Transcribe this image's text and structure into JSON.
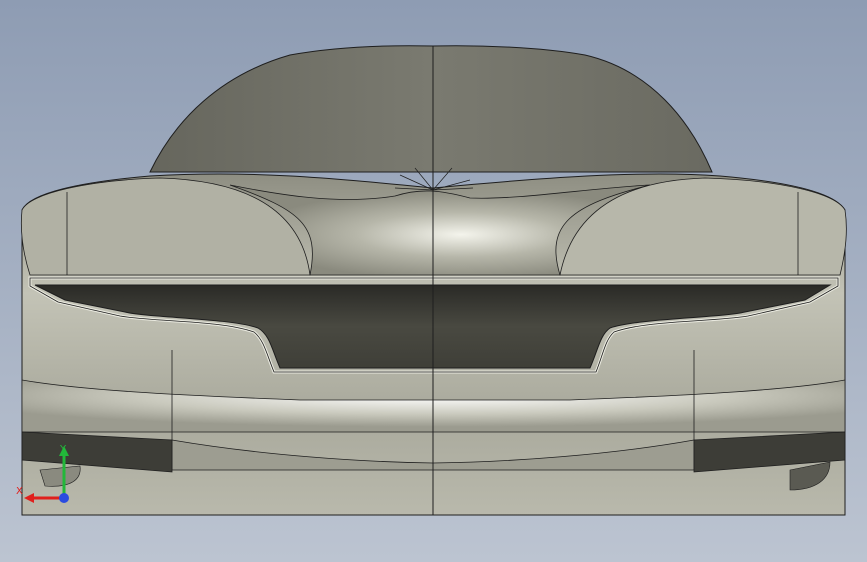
{
  "viewport": {
    "background_top": "#8e9cb3",
    "background_bottom": "#bcc4d1",
    "model_color": "#a9a99b",
    "edge_color": "#1e1e1e"
  },
  "triad": {
    "x_label": "X",
    "y_label": "Y",
    "x_color": "#e0201c",
    "y_color": "#22b83a",
    "z_color": "#2a4be0"
  }
}
